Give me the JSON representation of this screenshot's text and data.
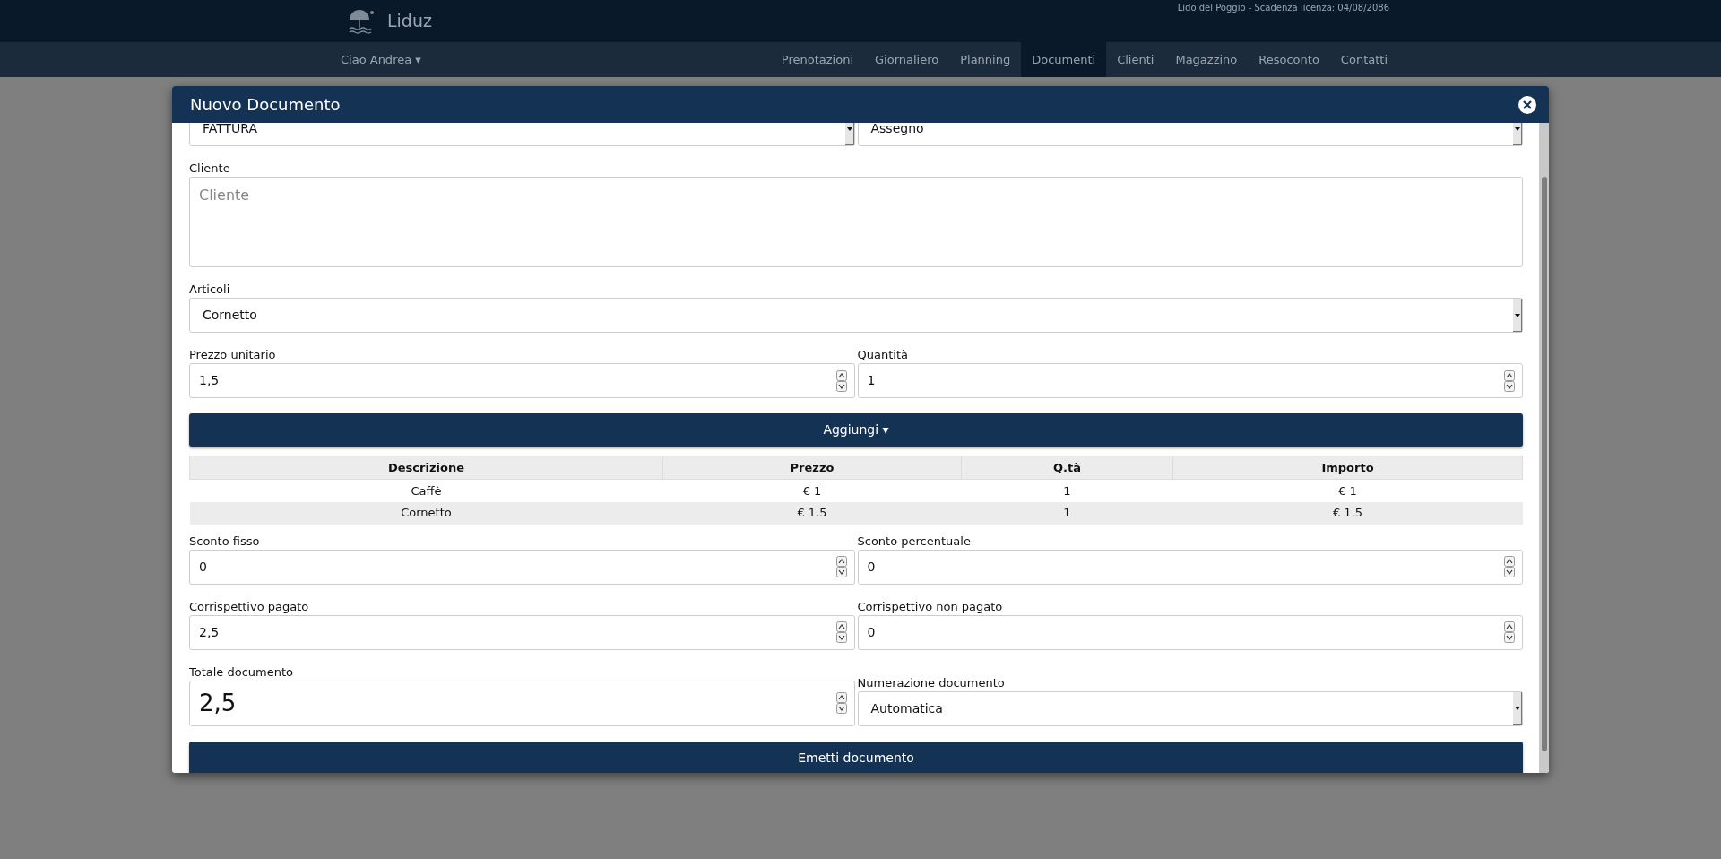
{
  "top_bar": {
    "logo": "Liduz",
    "license": "Lido del Poggio - Scadenza licenza: 04/08/2086"
  },
  "nav": {
    "user_menu": "Ciao Andrea ▾",
    "items": [
      {
        "label": "Prenotazioni",
        "selected": false
      },
      {
        "label": "Giornaliero",
        "selected": false
      },
      {
        "label": "Planning",
        "selected": false
      },
      {
        "label": "Documenti",
        "selected": true
      },
      {
        "label": "Clienti",
        "selected": false
      },
      {
        "label": "Magazzino",
        "selected": false
      },
      {
        "label": "Resoconto",
        "selected": false
      },
      {
        "label": "Contatti",
        "selected": false
      }
    ]
  },
  "dialog": {
    "title": "Nuovo Documento",
    "rows": [
      {
        "kind": "fields",
        "fields": [
          {
            "kind": "select",
            "value": "FATTURA"
          },
          {
            "kind": "select",
            "value": "Assegno"
          }
        ]
      },
      {
        "kind": "fields",
        "fields": [
          {
            "kind": "textarea",
            "label": "Cliente",
            "placeholder": "Cliente"
          }
        ]
      },
      {
        "kind": "fields",
        "fields": [
          {
            "kind": "select",
            "label": "Articoli",
            "value": "Cornetto"
          }
        ]
      },
      {
        "kind": "fields",
        "fields": [
          {
            "kind": "number",
            "label": "Prezzo unitario",
            "value": "1,5"
          },
          {
            "kind": "number",
            "label": "Quantità",
            "value": "1"
          }
        ]
      },
      {
        "kind": "button",
        "label": "Aggiungi ▾"
      },
      {
        "kind": "table",
        "columns": [
          "Descrizione",
          "Prezzo",
          "Q.tà",
          "Importo"
        ],
        "rows": [
          [
            "Caffè",
            "€ 1",
            "1",
            "€ 1"
          ],
          [
            "Cornetto",
            "€ 1.5",
            "1",
            "€ 1.5"
          ]
        ]
      },
      {
        "kind": "fields",
        "fields": [
          {
            "kind": "number",
            "label": "Sconto fisso",
            "value": "0"
          },
          {
            "kind": "number",
            "label": "Sconto percentuale",
            "value": "0"
          }
        ]
      },
      {
        "kind": "fields",
        "fields": [
          {
            "kind": "number",
            "label": "Corrispettivo pagato",
            "value": "2,5"
          },
          {
            "kind": "number",
            "label": "Corrispettivo non pagato",
            "value": "0"
          }
        ]
      },
      {
        "kind": "fields",
        "fields": [
          {
            "kind": "big_number",
            "label": "Totale documento",
            "value": "2,5"
          },
          {
            "kind": "select",
            "label": "Numerazione documento",
            "value": "Automatica"
          }
        ]
      },
      {
        "kind": "button",
        "label": "Emetti documento"
      }
    ]
  }
}
